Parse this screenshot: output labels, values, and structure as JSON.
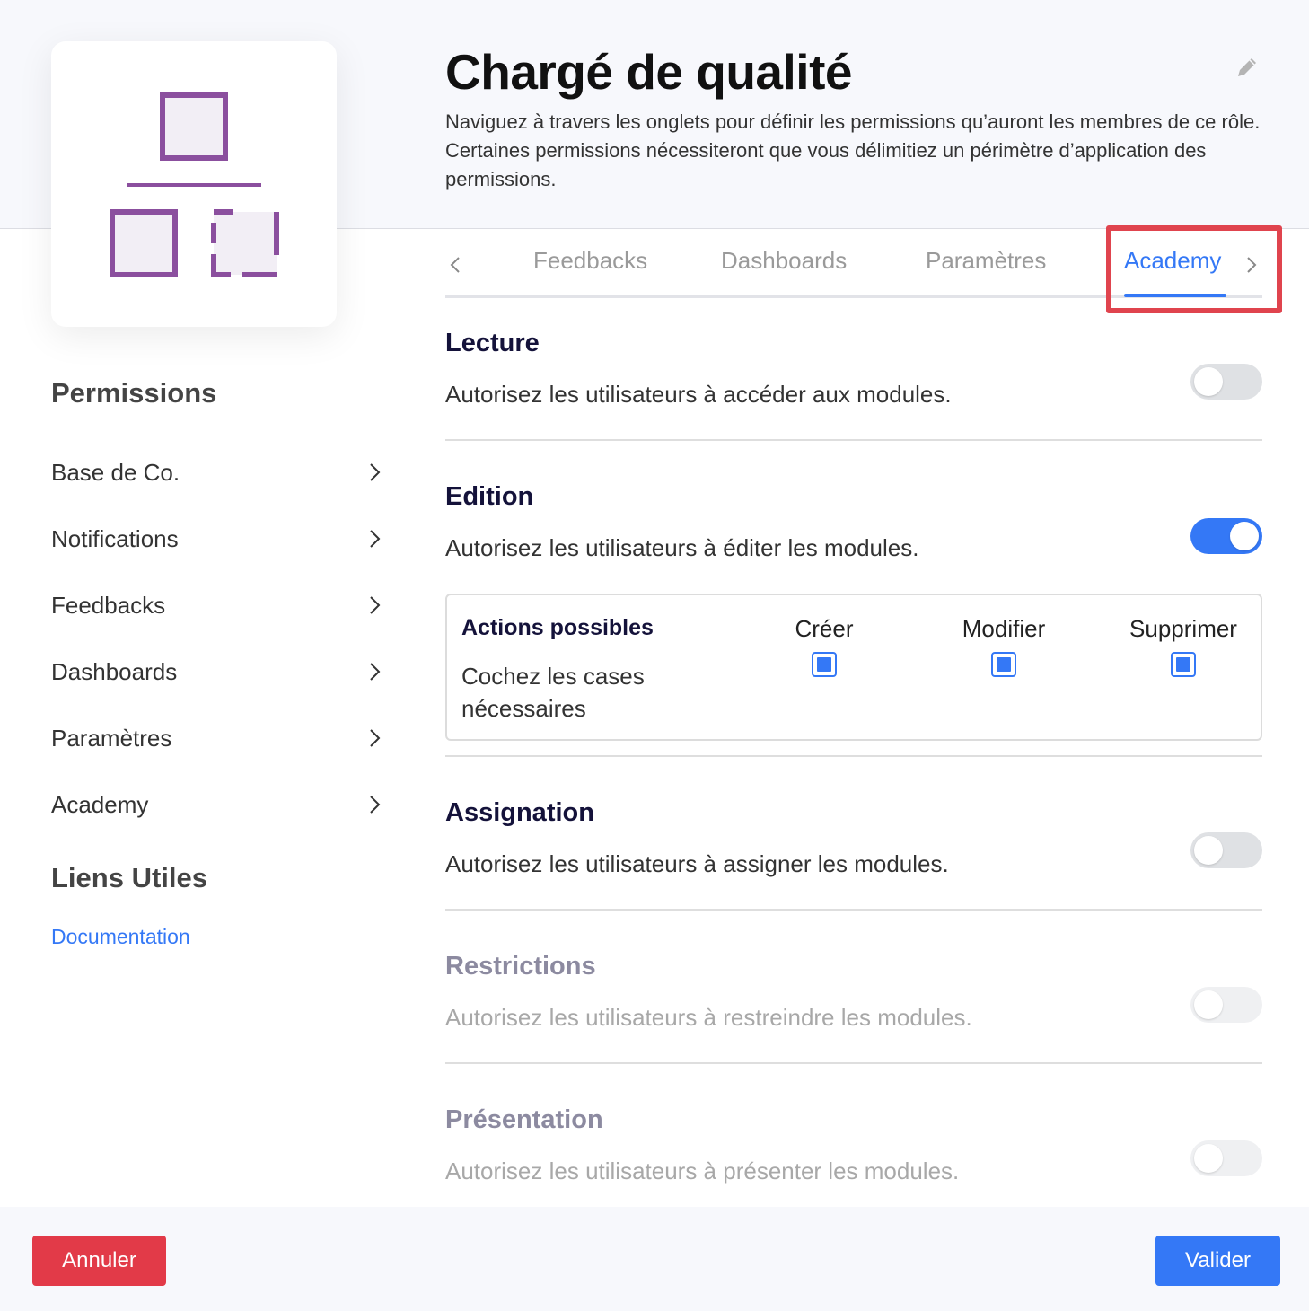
{
  "header": {
    "title": "Chargé de qualité",
    "description": "Naviguez à travers les onglets pour définir les permissions qu’auront les membres de ce rôle. Certaines permissions nécessiteront que vous délimitiez un périmètre d’application des permissions."
  },
  "sidebar": {
    "permissions_title": "Permissions",
    "items": [
      {
        "label": "Base de Co."
      },
      {
        "label": "Notifications"
      },
      {
        "label": "Feedbacks"
      },
      {
        "label": "Dashboards"
      },
      {
        "label": "Paramètres"
      },
      {
        "label": "Academy"
      }
    ],
    "links_title": "Liens Utiles",
    "links": [
      {
        "label": "Documentation"
      }
    ]
  },
  "tabs": {
    "items": [
      {
        "label": "Feedbacks",
        "active": false
      },
      {
        "label": "Dashboards",
        "active": false
      },
      {
        "label": "Paramètres",
        "active": false
      },
      {
        "label": "Academy",
        "active": true
      }
    ]
  },
  "permissions": [
    {
      "title": "Lecture",
      "description": "Autorisez les utilisateurs à accéder aux modules.",
      "enabled": false,
      "disabled": false
    },
    {
      "title": "Edition",
      "description": "Autorisez les utilisateurs à éditer les modules.",
      "enabled": true,
      "disabled": false
    },
    {
      "title": "Assignation",
      "description": "Autorisez les utilisateurs à assigner les modules.",
      "enabled": false,
      "disabled": false
    },
    {
      "title": "Restrictions",
      "description": "Autorisez les utilisateurs à restreindre les modules.",
      "enabled": false,
      "disabled": true
    },
    {
      "title": "Présentation",
      "description": "Autorisez les utilisateurs à présenter les modules.",
      "enabled": false,
      "disabled": true
    }
  ],
  "actions": {
    "title": "Actions possibles",
    "description": "Cochez les cases nécessaires",
    "options": [
      {
        "label": "Créer",
        "checked": true
      },
      {
        "label": "Modifier",
        "checked": true
      },
      {
        "label": "Supprimer",
        "checked": true
      }
    ]
  },
  "footer": {
    "cancel_label": "Annuler",
    "validate_label": "Valider"
  },
  "colors": {
    "accent": "#3478f6",
    "danger": "#e23a48",
    "logo": "#8b4f9e",
    "highlight": "#e0444e"
  },
  "icons": {
    "logo": "org-chart-icon",
    "edit": "pencil-icon",
    "chevron": "chevron-right-icon"
  }
}
